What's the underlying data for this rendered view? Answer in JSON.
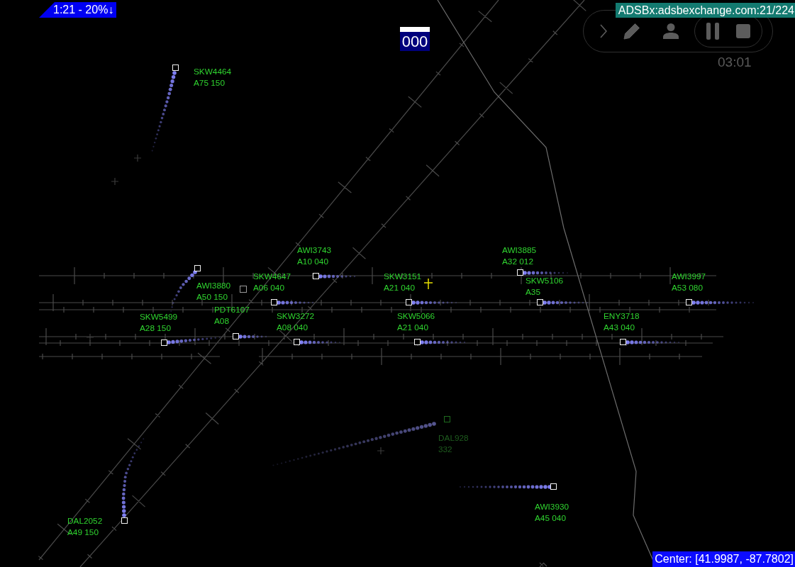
{
  "status_badge": {
    "text": "1:21 - 20%↓"
  },
  "squawk": {
    "code": "000"
  },
  "feed_label": "ADSBx:adsbexchange.com:21/224",
  "toolbar": {
    "timer": "03:01"
  },
  "aircraft": [
    {
      "callsign": "SKW4464",
      "data": "A75 150",
      "stale": false
    },
    {
      "callsign": "AWI3743",
      "data": "A10 040",
      "stale": false
    },
    {
      "callsign": "AWI3885",
      "data": "A32 012",
      "stale": false
    },
    {
      "callsign": "SKW4647",
      "data": "A06 040",
      "stale": false
    },
    {
      "callsign": "SKW3151",
      "data": "A21 040",
      "stale": false
    },
    {
      "callsign": "SKW5106",
      "data": "A35",
      "stale": false
    },
    {
      "callsign": "AWI3997",
      "data": "A53 080",
      "stale": false
    },
    {
      "callsign": "AWI3880",
      "data": "A50 150",
      "stale": false
    },
    {
      "callsign": "PDT6107",
      "data": "A08",
      "stale": false
    },
    {
      "callsign": "SKW5499",
      "data": "A28 150",
      "stale": false
    },
    {
      "callsign": "SKW3272",
      "data": "A08 040",
      "stale": false
    },
    {
      "callsign": "SKW5066",
      "data": "A21 040",
      "stale": false
    },
    {
      "callsign": "ENY3718",
      "data": "A43 040",
      "stale": false
    },
    {
      "callsign": "DAL928",
      "data": "332",
      "stale": true
    },
    {
      "callsign": "AWI3930",
      "data": "A45 040",
      "stale": false
    },
    {
      "callsign": "DAL2052",
      "data": "A49 150",
      "stale": false
    }
  ],
  "center_readout": "Center: [41.9987, -87.7802]"
}
